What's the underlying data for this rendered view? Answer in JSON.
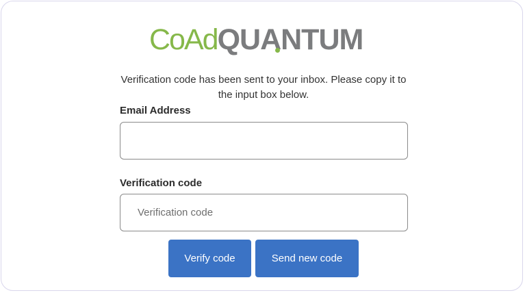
{
  "logo": {
    "part1": "CoAd",
    "part2_a": "QU",
    "part2_b": "ANTUM",
    "colors": {
      "green": "#86b84a",
      "gray": "#7b7c7e"
    }
  },
  "intro_text": "Verification code has been sent to your inbox. Please copy it to the input box below.",
  "email": {
    "label": "Email Address",
    "value": "",
    "placeholder": ""
  },
  "verification": {
    "label": "Verification code",
    "value": "",
    "placeholder": "Verification code"
  },
  "buttons": {
    "verify": "Verify code",
    "send_new": "Send new code"
  },
  "colors": {
    "primary": "#3b73c5",
    "card_border": "#d9d6ec"
  }
}
